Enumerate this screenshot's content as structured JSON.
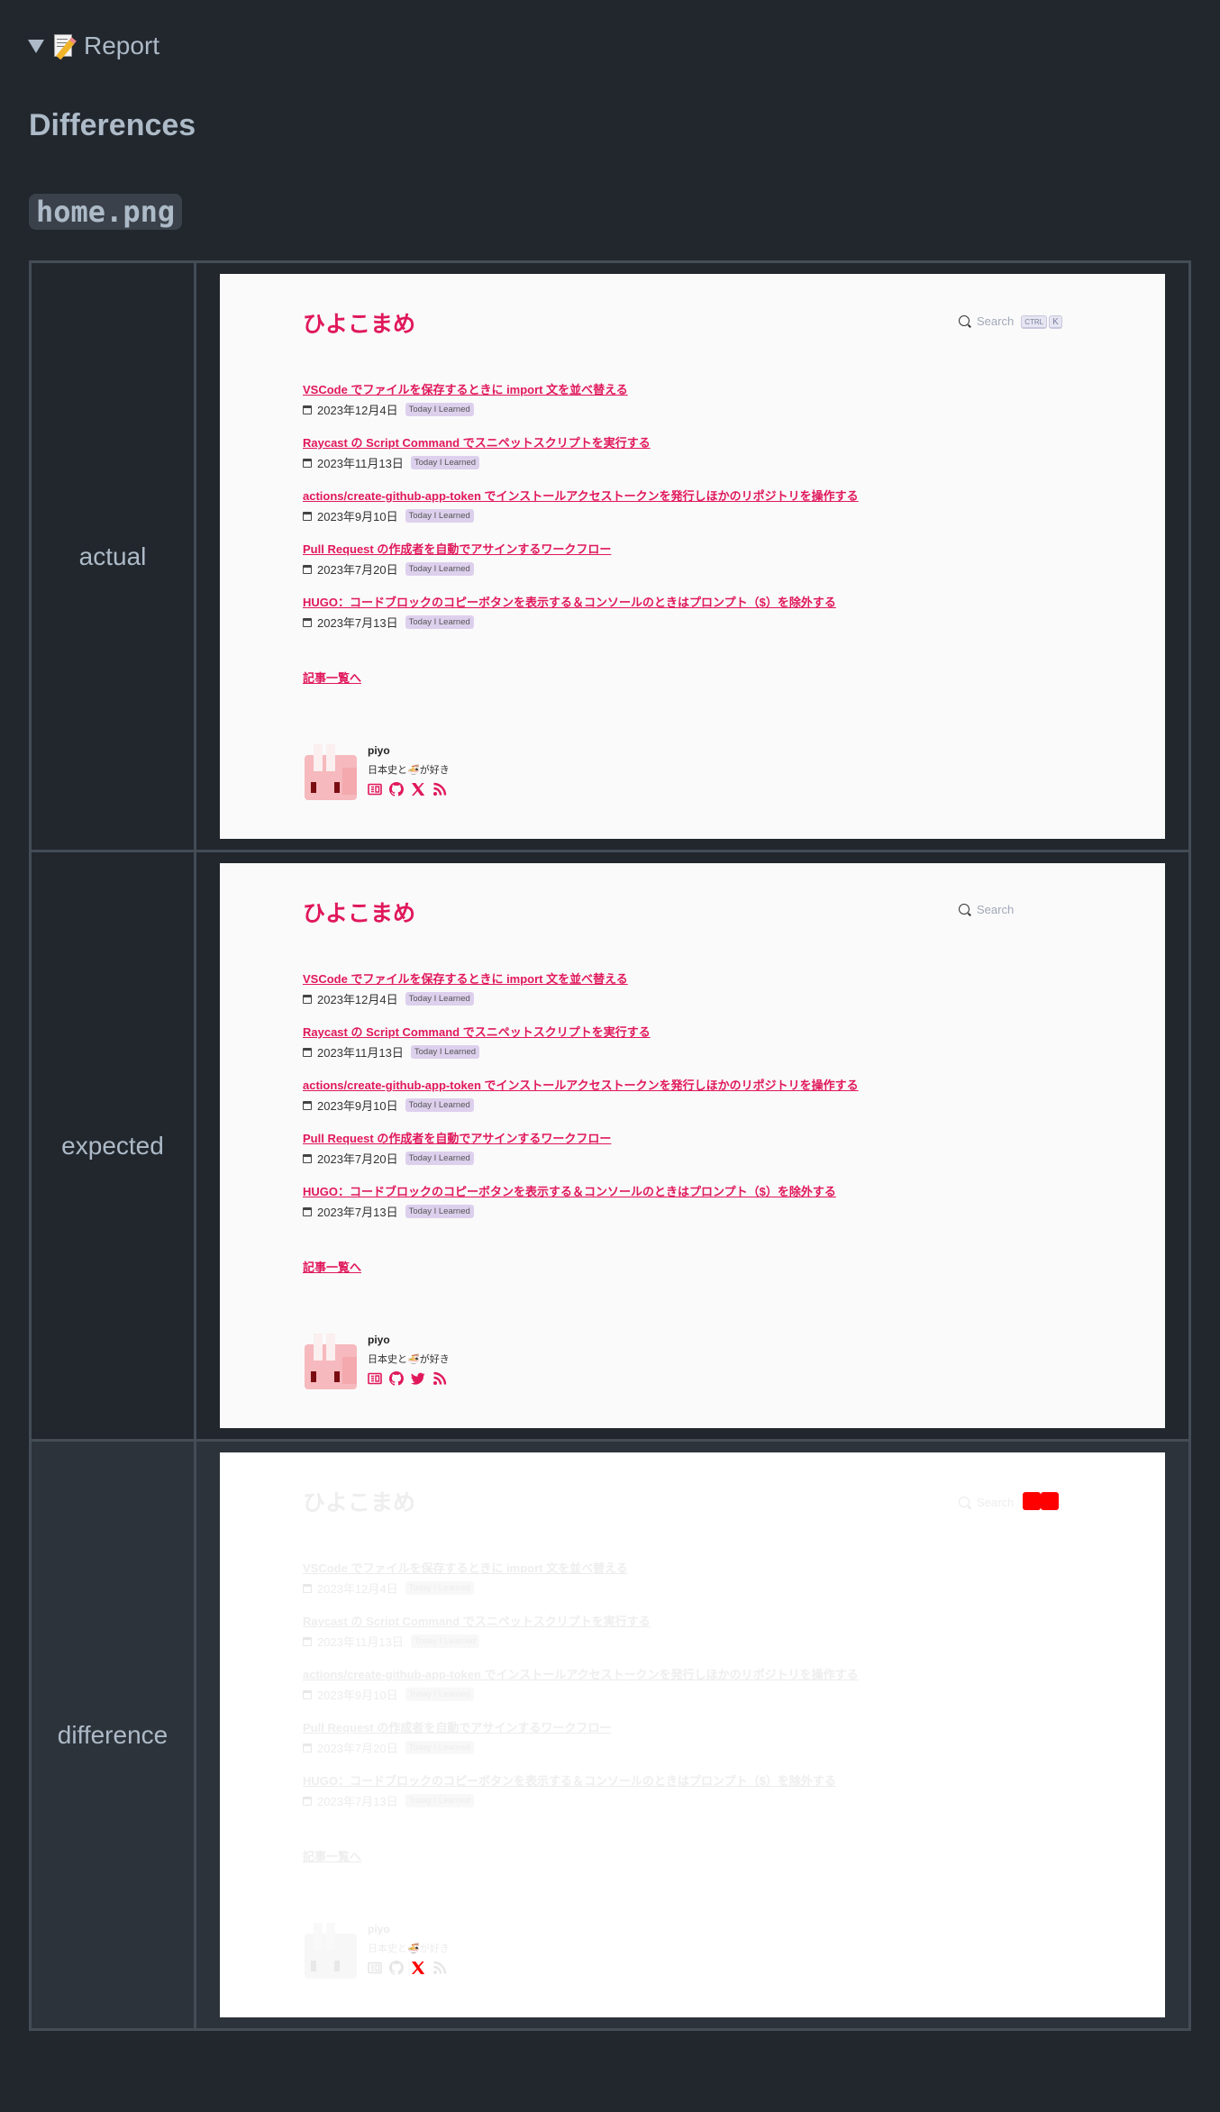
{
  "report": {
    "summary_label": "Report",
    "summary_icon": "memo-icon",
    "heading": "Differences",
    "filename": "home.png"
  },
  "rows": [
    {
      "label": "actual"
    },
    {
      "label": "expected"
    },
    {
      "label": "difference"
    }
  ],
  "site": {
    "title": "ひよこまめ",
    "search_label": "Search",
    "kbd_ctrl": "CTRL",
    "kbd_k": "K",
    "posts": [
      {
        "title": "VSCode でファイルを保存するときに import 文を並べ替える",
        "date": "2023年12月4日",
        "tag": "Today I Learned"
      },
      {
        "title": "Raycast の Script Command でスニペットスクリプトを実行する",
        "date": "2023年11月13日",
        "tag": "Today I Learned"
      },
      {
        "title": "actions/create-github-app-token でインストールアクセストークンを発行しほかのリポジトリを操作する",
        "date": "2023年9月10日",
        "tag": "Today I Learned"
      },
      {
        "title": "Pull Request の作成者を自動でアサインするワークフロー",
        "date": "2023年7月20日",
        "tag": "Today I Learned"
      },
      {
        "title": "HUGO：コードブロックのコピーボタンを表示する＆コンソールのときはプロンプト（$）を除外する",
        "date": "2023年7月13日",
        "tag": "Today I Learned"
      }
    ],
    "more_link": "記事一覧へ",
    "profile": {
      "name": "piyo",
      "bio": "日本史と🍜が好き",
      "links_actual": [
        "newspaper-icon",
        "github-icon",
        "x-icon",
        "rss-icon"
      ],
      "links_expected": [
        "newspaper-icon",
        "github-icon",
        "twitter-bird-icon",
        "rss-icon"
      ]
    }
  },
  "colors": {
    "accent": "#e0185b",
    "page_bg": "#22272e",
    "diff_row_bg": "#2d333b",
    "border": "#444c56",
    "diff_highlight": "#ff0000"
  }
}
